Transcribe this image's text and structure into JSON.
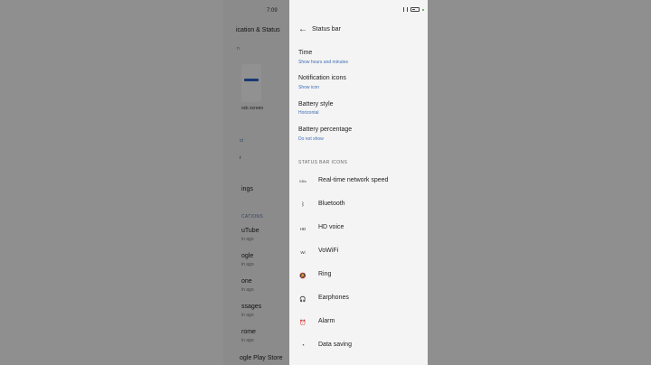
{
  "status_bar": {
    "time": "7:09"
  },
  "background_page": {
    "title": "ication & Status",
    "preview_label": "ock screen",
    "partial_items": [
      {
        "text": "n",
        "type": "head"
      },
      {
        "text": "ct",
        "type": "text"
      },
      {
        "text": "r",
        "type": "text"
      },
      {
        "text": "ings",
        "type": "text"
      },
      {
        "text": "CATIONS",
        "type": "head"
      }
    ],
    "apps": [
      {
        "name": "uTube",
        "sub": "in ago"
      },
      {
        "name": "ogle",
        "sub": "in ago"
      },
      {
        "name": "one",
        "sub": "in ago"
      },
      {
        "name": "ssages",
        "sub": "in ago"
      },
      {
        "name": "rome",
        "sub": "in ago"
      },
      {
        "name": "ogle Play Store",
        "sub": ""
      }
    ]
  },
  "panel": {
    "title": "Status bar",
    "settings": [
      {
        "title": "Time",
        "sub": "Show hours and minutes"
      },
      {
        "title": "Notification icons",
        "sub": "Show icon"
      },
      {
        "title": "Battery style",
        "sub": "Horizontal"
      },
      {
        "title": "Battery percentage",
        "sub": "Do not show"
      }
    ],
    "section_header": "STATUS BAR ICONS",
    "icon_items": [
      {
        "icon": "network-speed-icon",
        "glyph": "KB/s",
        "label": "Real-time network speed"
      },
      {
        "icon": "bluetooth-icon",
        "glyph": "ᛒ",
        "label": "Bluetooth"
      },
      {
        "icon": "hd-voice-icon",
        "glyph": "HD",
        "label": "HD voice"
      },
      {
        "icon": "vowifi-icon",
        "glyph": "Wi",
        "label": "VoWiFi"
      },
      {
        "icon": "ring-icon",
        "glyph": "🔕",
        "label": "Ring"
      },
      {
        "icon": "earphones-icon",
        "glyph": "🎧",
        "label": "Earphones"
      },
      {
        "icon": "alarm-icon",
        "glyph": "⏰",
        "label": "Alarm"
      },
      {
        "icon": "data-saving-icon",
        "glyph": "◔",
        "label": "Data saving"
      }
    ]
  }
}
